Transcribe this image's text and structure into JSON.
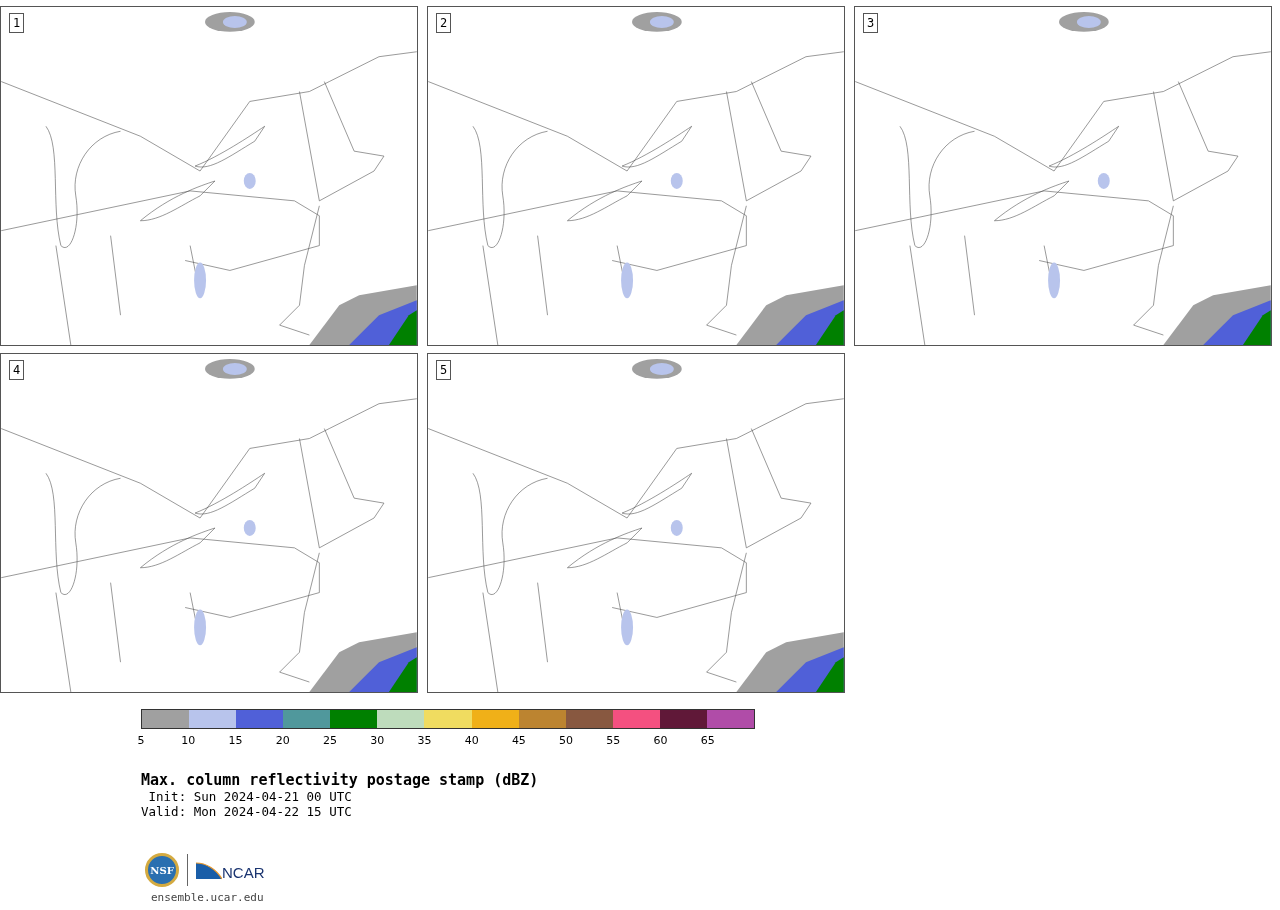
{
  "panels": [
    {
      "label": "1"
    },
    {
      "label": "2"
    },
    {
      "label": "3"
    },
    {
      "label": "4"
    },
    {
      "label": "5"
    }
  ],
  "colorbar": {
    "segments": [
      {
        "color": "#a0a0a0",
        "tick": "5"
      },
      {
        "color": "#b8c4ec",
        "tick": "10"
      },
      {
        "color": "#5060d8",
        "tick": "15"
      },
      {
        "color": "#50989c",
        "tick": "20"
      },
      {
        "color": "#008000",
        "tick": "25"
      },
      {
        "color": "#bedcbc",
        "tick": "30"
      },
      {
        "color": "#f0dc60",
        "tick": "35"
      },
      {
        "color": "#f0b018",
        "tick": "40"
      },
      {
        "color": "#bc8430",
        "tick": "45"
      },
      {
        "color": "#885840",
        "tick": "50"
      },
      {
        "color": "#f45080",
        "tick": "55"
      },
      {
        "color": "#601838",
        "tick": "60"
      },
      {
        "color": "#b04ca8",
        "tick": "65"
      }
    ]
  },
  "title": "Max. column reflectivity postage stamp (dBZ)",
  "init": " Init: Sun 2024-04-21 00 UTC",
  "valid": "Valid: Mon 2024-04-22 15 UTC",
  "logos": {
    "nsf": "NSF",
    "ncar": "NCAR"
  },
  "footer": "ensemble.ucar.edu"
}
